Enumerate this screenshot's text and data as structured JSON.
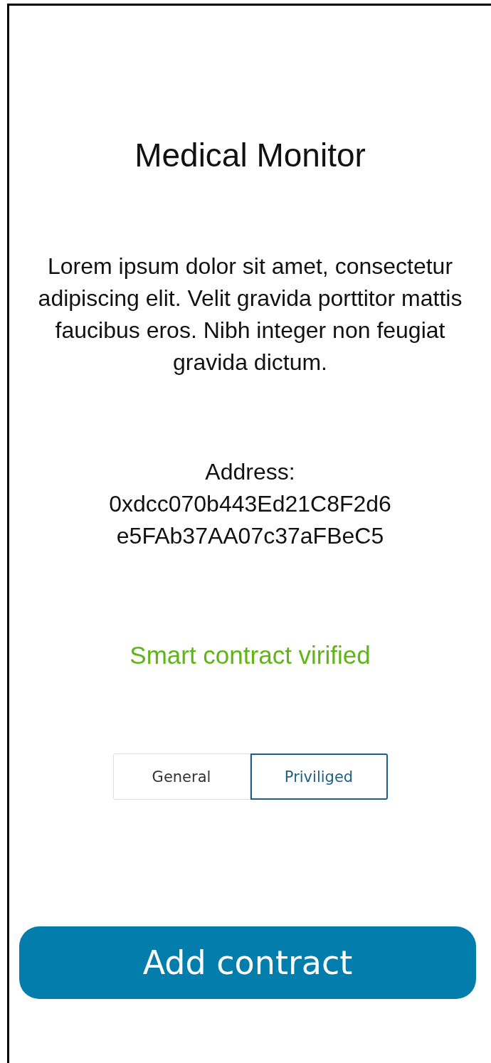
{
  "title": "Medical Monitor",
  "description": "Lorem ipsum dolor sit amet, consectetur adipiscing elit. Velit gravida porttitor mattis faucibus eros. Nibh integer non feugiat gravida dictum.",
  "address": {
    "label": "Address:",
    "lines": [
      "0xdcc070b443Ed21C8F2d6",
      "e5FAb37AA07c37aFBeC5"
    ]
  },
  "status": {
    "text": "Smart contract virified",
    "verified": true
  },
  "tabs": [
    {
      "label": "General",
      "selected": false
    },
    {
      "label": "Priviliged",
      "selected": true
    }
  ],
  "button": {
    "label": "Add contract"
  }
}
